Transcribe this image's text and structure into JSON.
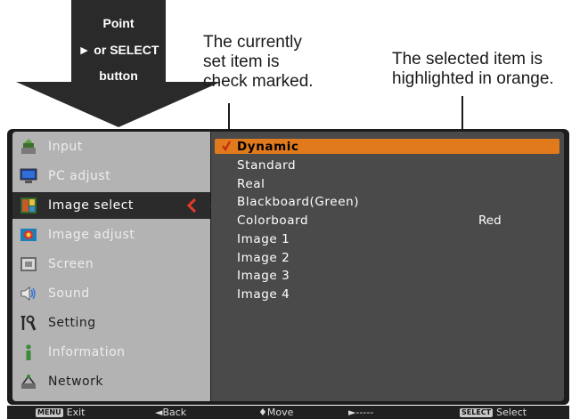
{
  "annotations": {
    "arrow_lines": [
      "Point",
      "► or SELECT",
      "button"
    ],
    "check_callout": [
      "The currently",
      "set item is",
      "check marked."
    ],
    "highlight_callout": [
      "The selected item is",
      "highlighted in orange."
    ]
  },
  "sidebar": {
    "items": [
      {
        "label": "Input",
        "icon": "input-icon"
      },
      {
        "label": "PC adjust",
        "icon": "pc-adjust-icon"
      },
      {
        "label": "Image select",
        "icon": "image-select-icon",
        "selected": true
      },
      {
        "label": "Image adjust",
        "icon": "image-adjust-icon"
      },
      {
        "label": "Screen",
        "icon": "screen-icon"
      },
      {
        "label": "Sound",
        "icon": "sound-icon"
      },
      {
        "label": "Setting",
        "icon": "setting-icon"
      },
      {
        "label": "Information",
        "icon": "information-icon"
      },
      {
        "label": "Network",
        "icon": "network-icon"
      }
    ]
  },
  "options": [
    {
      "label": "Dynamic",
      "checked": true,
      "highlighted": true
    },
    {
      "label": "Standard"
    },
    {
      "label": "Real"
    },
    {
      "label": "Blackboard(Green)"
    },
    {
      "label": "Colorboard",
      "value": "Red"
    },
    {
      "label": "Image 1"
    },
    {
      "label": "Image 2"
    },
    {
      "label": "Image 3"
    },
    {
      "label": "Image 4"
    }
  ],
  "bottom_bar": {
    "exit_key": "MENU",
    "exit": "Exit",
    "back": "◄Back",
    "move": "♦Move",
    "next": "►-----",
    "select_key": "SELECT",
    "select": "Select"
  },
  "colors": {
    "highlight": "#e07a1c",
    "panel_bg": "#1c1c1c",
    "sidebar_bg": "#b3b3b3",
    "content_bg": "#4a4a4a",
    "back_chevron": "#e23a2a"
  }
}
